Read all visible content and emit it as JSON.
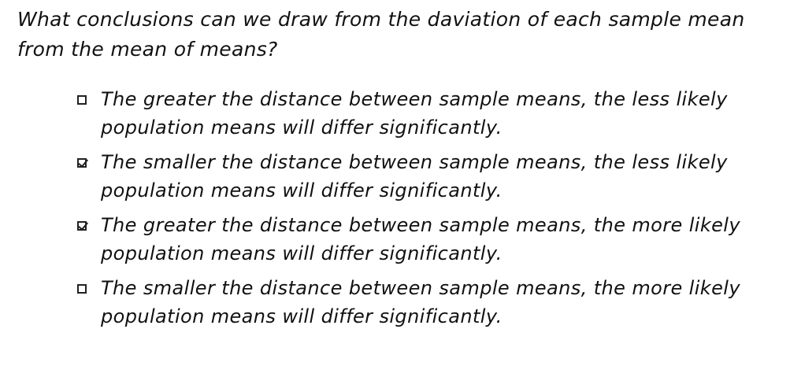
{
  "question": "What conclusions can we draw from the daviation of each sample mean from the mean of means?",
  "options": [
    {
      "text": "The greater the distance between sample means, the less likely population means will differ significantly.",
      "checked": false
    },
    {
      "text": "The smaller the distance between sample means, the less likely population means will differ significantly.",
      "checked": true
    },
    {
      "text": "The greater the distance between sample means, the more likely population means will differ significantly.",
      "checked": true
    },
    {
      "text": "The smaller the distance between sample means, the more likely population means will differ significantly.",
      "checked": false
    }
  ]
}
